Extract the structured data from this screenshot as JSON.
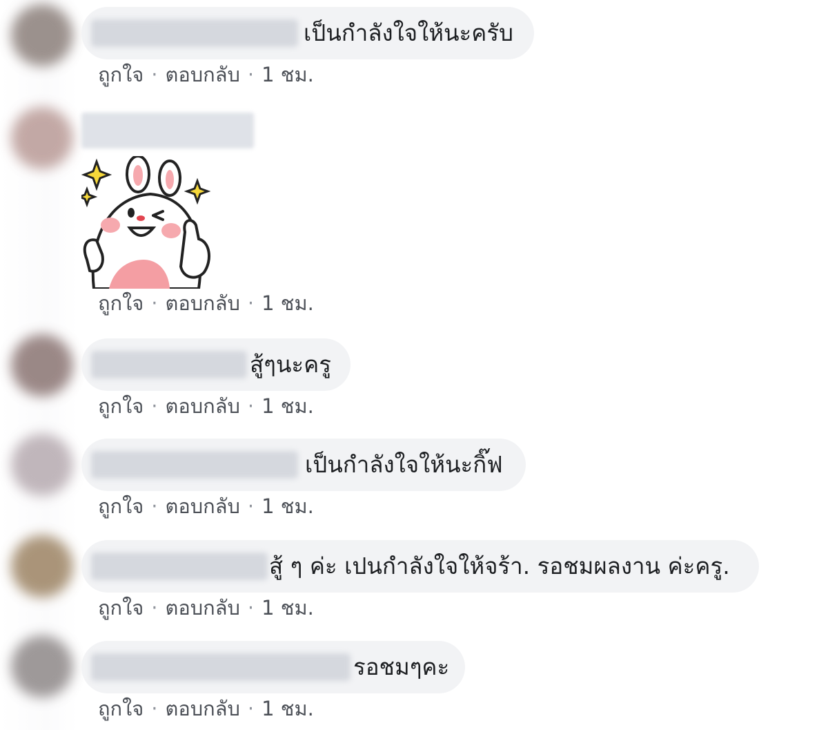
{
  "actions": {
    "like": "ถูกใจ",
    "reply": "ตอบกลับ",
    "separator": "·"
  },
  "comments": [
    {
      "text": "เป็นกำลังใจให้นะครับ",
      "time": "1 ชม."
    },
    {
      "text": "",
      "sticker": "bunny-thumbs-up-sticker",
      "time": "1 ชม."
    },
    {
      "text": "สู้ๆนะครู",
      "time": "1 ชม."
    },
    {
      "text": "เป็นกำลังใจให้นะกิ๊ฟ",
      "time": "1 ชม."
    },
    {
      "text": "สู้ ๆ ค่ะ เปนกำลังใจให้จร้า. รอชมผลงาน ค่ะครู.",
      "time": "1 ชม."
    },
    {
      "text": "รอชมๆคะ",
      "time": "1 ชม."
    }
  ],
  "colors": {
    "bubble": "#f2f3f5",
    "meta_text": "#4b4f56",
    "blur_name": "#d5d8de"
  }
}
